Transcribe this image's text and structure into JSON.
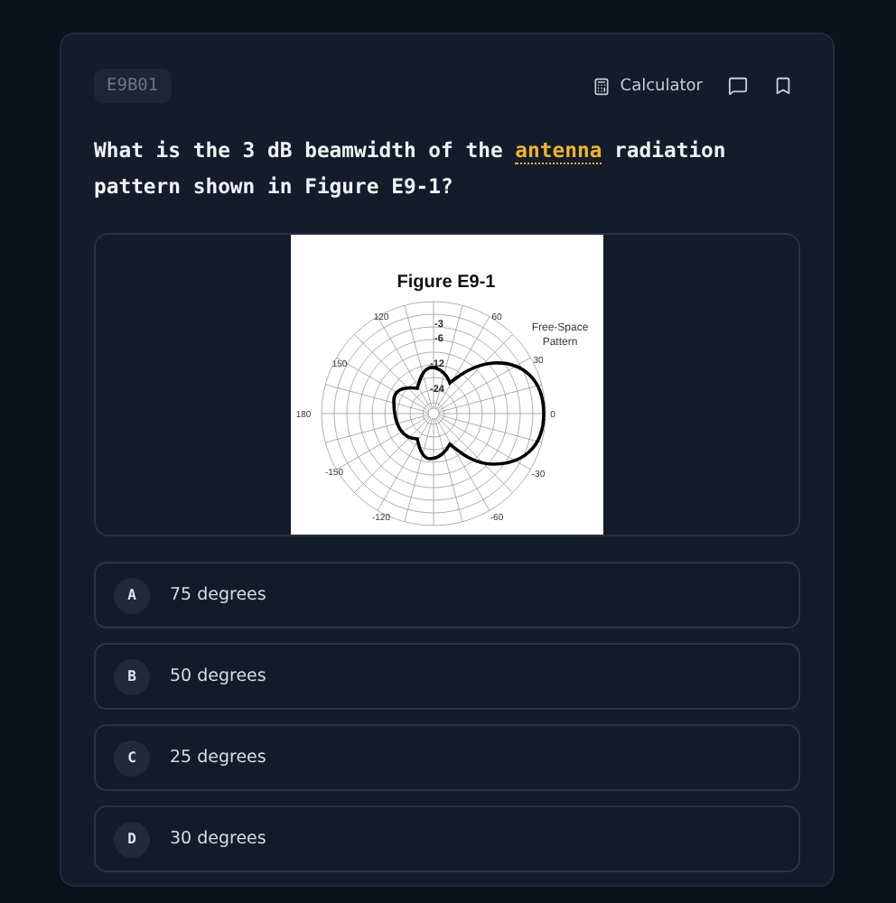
{
  "question": {
    "code": "E9B01",
    "tools": [
      "Calculator"
    ],
    "text": [
      {
        "kind": "plain",
        "text": "What is the 3 dB beamwidth of the "
      },
      {
        "kind": "term",
        "text": "antenna"
      },
      {
        "kind": "plain",
        "text": " radiation pattern shown in Figure E9-1?"
      }
    ]
  },
  "figure": {
    "title": "Figure E9-1",
    "note": [
      "Free-Space",
      "Pattern"
    ],
    "angle_labels": [
      "0",
      "30",
      "60",
      "120",
      "150",
      "180",
      "-150",
      "-120",
      "-60",
      "-30"
    ],
    "ring_labels": [
      "-3",
      "-6",
      "-12",
      "-24"
    ]
  },
  "options": [
    {
      "letter": "A",
      "text": "75 degrees",
      "selected": false
    },
    {
      "letter": "B",
      "text": "50 degrees",
      "selected": false
    },
    {
      "letter": "C",
      "text": "25 degrees",
      "selected": false
    },
    {
      "letter": "D",
      "text": "30 degrees",
      "selected": false
    }
  ]
}
